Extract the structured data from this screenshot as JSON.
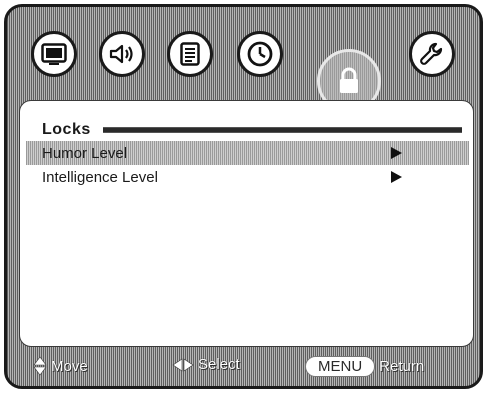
{
  "top_icons": [
    {
      "name": "picture-icon"
    },
    {
      "name": "sound-icon"
    },
    {
      "name": "setup-icon"
    },
    {
      "name": "clock-icon"
    },
    {
      "name": "lock-icon",
      "selected": true
    },
    {
      "name": "wrench-icon"
    }
  ],
  "section": {
    "title": "Locks"
  },
  "menu": {
    "items": [
      {
        "label": "Humor Level",
        "highlighted": true,
        "has_submenu": true
      },
      {
        "label": "Intelligence Level",
        "highlighted": false,
        "has_submenu": true
      }
    ]
  },
  "hints": {
    "move_label": "Move",
    "select_label": "Select",
    "menu_key": "MENU",
    "return_label": "Return"
  },
  "colors": {
    "panel_background": "#ffffff",
    "highlight": "#b4b4b4",
    "frame": "#8a8a8a",
    "text": "#1a1a1a"
  }
}
